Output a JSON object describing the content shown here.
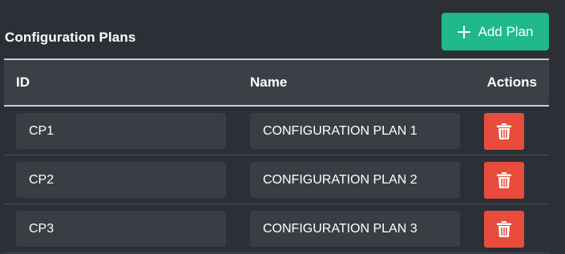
{
  "header": {
    "title": "Configuration Plans",
    "add_button_label": "Add Plan",
    "add_button_icon": "plus-icon"
  },
  "table": {
    "columns": [
      "ID",
      "Name",
      "Actions"
    ],
    "rows": [
      {
        "id": "CP1",
        "name": "CONFIGURATION PLAN 1",
        "action_icon": "trash-icon"
      },
      {
        "id": "CP2",
        "name": "CONFIGURATION PLAN 2",
        "action_icon": "trash-icon"
      },
      {
        "id": "CP3",
        "name": "CONFIGURATION PLAN 3",
        "action_icon": "trash-icon"
      }
    ]
  },
  "colors": {
    "background": "#2c3036",
    "header_row": "#3b4047",
    "input": "#3a3e44",
    "accent_green": "#1fb98a",
    "danger_red": "#e94c3c"
  }
}
